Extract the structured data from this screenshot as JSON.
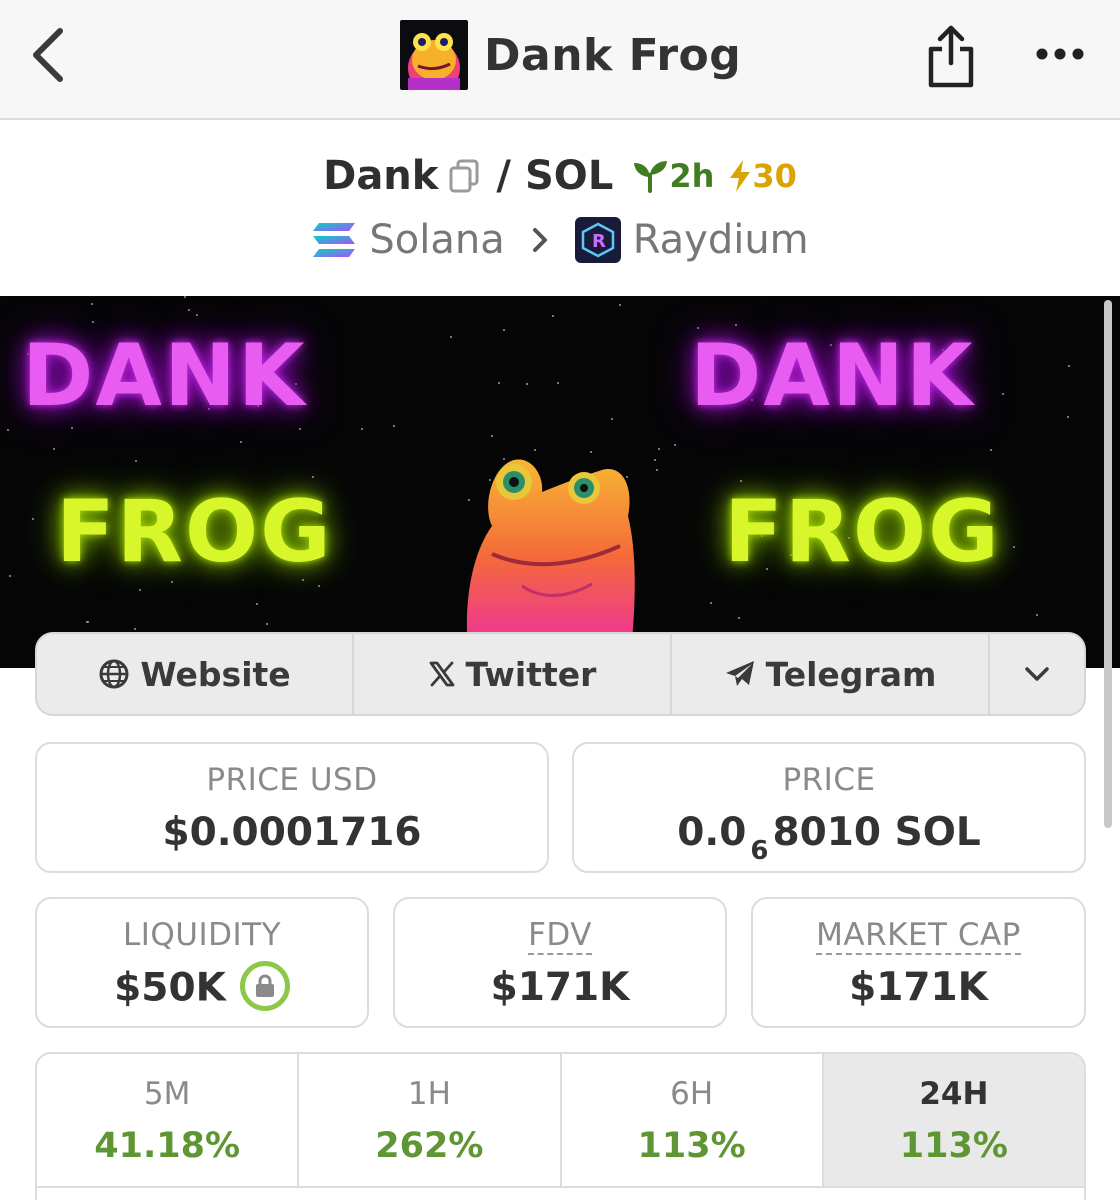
{
  "nav": {
    "title": "Dank Frog",
    "back_icon": "chevron-left-icon",
    "share_icon": "share-icon",
    "more_icon": "more-horizontal-icon"
  },
  "pair": {
    "base": "Dank",
    "separator": "/",
    "quote": "SOL",
    "age": "2h",
    "boost": "30",
    "colors": {
      "age": "#3f7d20",
      "boost": "#d9a400"
    }
  },
  "chain": {
    "name": "Solana",
    "dex": "Raydium"
  },
  "banner": {
    "left_top": "DANK",
    "left_bottom": "FROG",
    "right_top": "DANK",
    "right_bottom": "FROG"
  },
  "social": {
    "website": "Website",
    "twitter": "Twitter",
    "telegram": "Telegram"
  },
  "stats": {
    "price_usd_label": "PRICE USD",
    "price_usd_value": "$0.0001716",
    "price_label": "PRICE",
    "price_prefix": "0.0",
    "price_sub": "6",
    "price_suffix": "8010 SOL",
    "liquidity_label": "LIQUIDITY",
    "liquidity_value": "$50K",
    "fdv_label": "FDV",
    "fdv_value": "$171K",
    "mcap_label": "MARKET CAP",
    "mcap_value": "$171K"
  },
  "timeframes": [
    {
      "label": "5M",
      "value": "41.18%"
    },
    {
      "label": "1H",
      "value": "262%"
    },
    {
      "label": "6H",
      "value": "113%"
    },
    {
      "label": "24H",
      "value": "113%"
    }
  ],
  "active_timeframe": "24H",
  "colors": {
    "positive": "#5e9634",
    "lock": "#8cc84b"
  }
}
